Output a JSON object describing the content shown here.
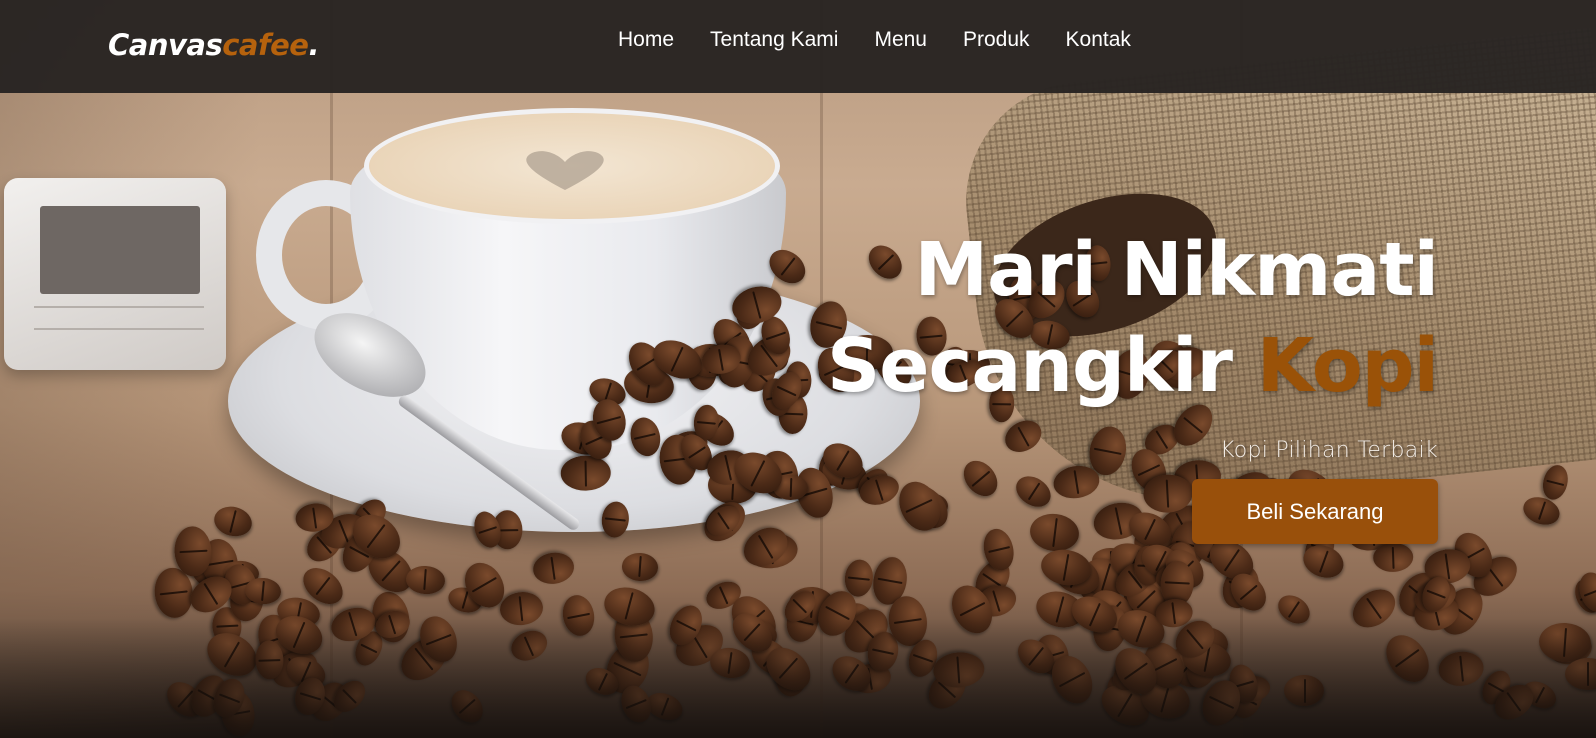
{
  "brand": {
    "logo_main": "Canvas",
    "logo_accent": "cafee",
    "logo_dot": "."
  },
  "nav": {
    "items": [
      {
        "label": "Home"
      },
      {
        "label": "Tentang Kami"
      },
      {
        "label": "Menu"
      },
      {
        "label": "Produk"
      },
      {
        "label": "Kontak"
      }
    ]
  },
  "hero": {
    "title_line1": "Mari Nikmati",
    "title_line2_main": "Secangkir ",
    "title_line2_accent": "Kopi",
    "subtitle": "Kopi Pilihan Terbaik",
    "cta_label": "Beli Sekarang"
  },
  "colors": {
    "accent": "#9a5208",
    "navbar_bg": "#282422",
    "text": "#ffffff"
  },
  "icons": {
    "background": "coffee-cup-and-beans-photo"
  }
}
